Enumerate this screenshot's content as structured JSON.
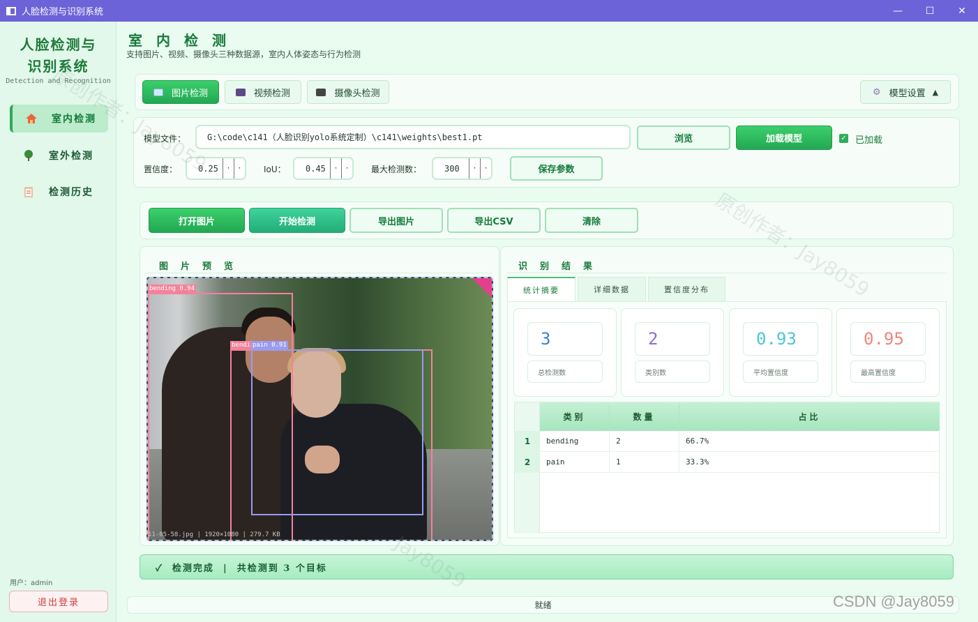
{
  "window": {
    "title": "人脸检测与识别系统",
    "minimize": "—",
    "maximize": "☐",
    "close": "✕"
  },
  "sidebar": {
    "brand_line1": "人脸检测与",
    "brand_line2": "识别系统",
    "brand_sub": "Detection and Recognition",
    "items": [
      {
        "label": "室内检测",
        "icon": "house-icon"
      },
      {
        "label": "室外检测",
        "icon": "tree-icon"
      },
      {
        "label": "检测历史",
        "icon": "clipboard-icon"
      }
    ],
    "user": "用户：admin",
    "logout": "退出登录"
  },
  "header": {
    "title": "室内检测",
    "subtitle": "支持图片、视频、摄像头三种数据源，室内人体姿态与行为检测"
  },
  "source_tabs": {
    "image": "图片检测",
    "video": "视频检测",
    "camera": "摄像头检测",
    "model_settings": "模型设置",
    "model_settings_arrow": "▲"
  },
  "model": {
    "file_label": "模型文件：",
    "path": "G:\\code\\c141（人脸识别yolo系统定制）\\c141\\weights\\best1.pt",
    "browse": "浏览",
    "load": "加载模型",
    "loaded_label": "已加载",
    "loaded": true,
    "conf_label": "置信度：",
    "conf": "0.25",
    "iou_label": "IoU：",
    "iou": "0.45",
    "max_label": "最大检测数：",
    "max": "300",
    "save": "保存参数"
  },
  "actions": {
    "open": "打开图片",
    "start": "开始检测",
    "export_img": "导出图片",
    "export_csv": "导出CSV",
    "clear": "清除"
  },
  "preview": {
    "title": "图片预览",
    "info": "11-05-58.jpg  |  1920×1080  |  279.7 KB",
    "detections": [
      {
        "label": "bending 0.94",
        "color": "#f4829a"
      },
      {
        "label": "bending",
        "color": "#f4829a"
      },
      {
        "label": "pain 0.91",
        "color": "#9a9cf0"
      }
    ]
  },
  "results": {
    "title": "识别结果",
    "tabs": [
      "统计摘要",
      "详细数据",
      "置信度分布"
    ],
    "stats": [
      {
        "value": "3",
        "label": "总检测数",
        "color": "#3d7fd6"
      },
      {
        "value": "2",
        "label": "类别数",
        "color": "#8a6cd6"
      },
      {
        "value": "0.93",
        "label": "平均置信度",
        "color": "#4cc6d6"
      },
      {
        "value": "0.95",
        "label": "最高置信度",
        "color": "#f0857c"
      }
    ],
    "columns": [
      "类别",
      "数量",
      "占比"
    ],
    "rows": [
      {
        "num": "1",
        "cls": "bending",
        "count": "2",
        "ratio": "66.7%"
      },
      {
        "num": "2",
        "cls": "pain",
        "count": "1",
        "ratio": "33.3%"
      }
    ]
  },
  "status": {
    "message": "✓  检测完成  |  共检测到 3 个目标",
    "bottom": "就绪"
  },
  "watermarks": {
    "text1": "原创作者：Jay8059",
    "text2": "原创作者：Jay8059",
    "text3": "Jay8059",
    "csdn": "CSDN @Jay8059"
  }
}
